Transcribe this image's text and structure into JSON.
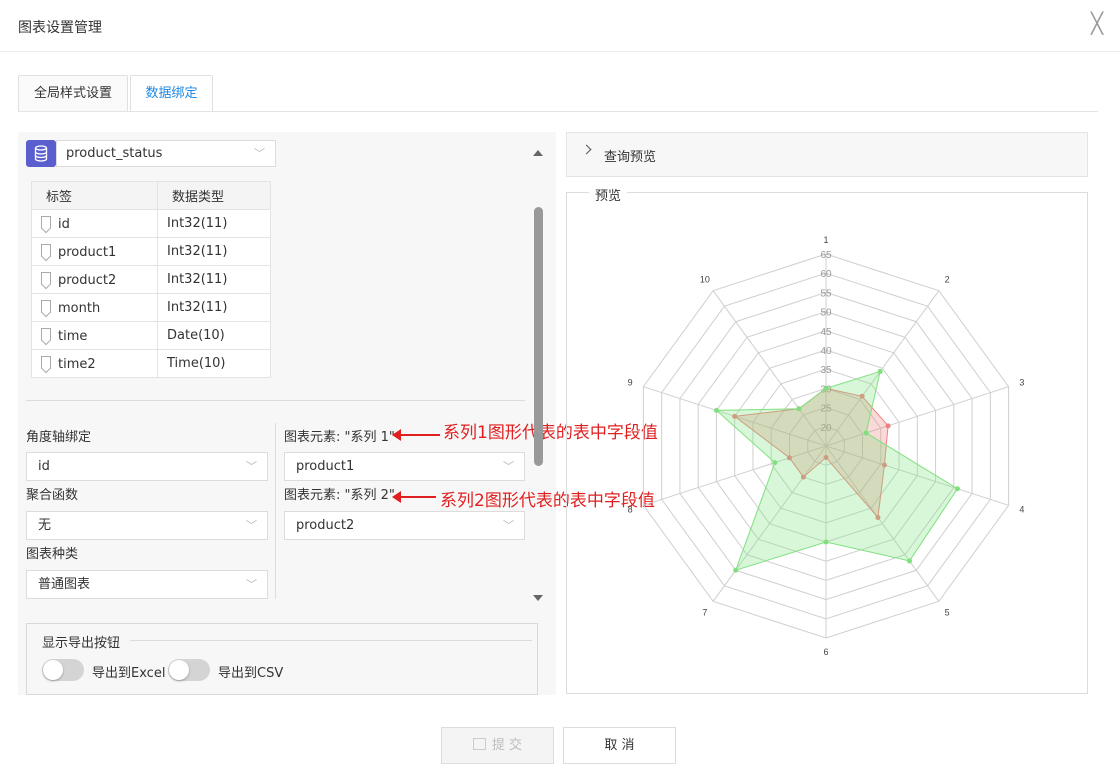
{
  "dialog": {
    "title": "图表设置管理",
    "close_glyph": "╳"
  },
  "tabs": [
    {
      "label": "全局样式设置",
      "active": false
    },
    {
      "label": "数据绑定",
      "active": true
    }
  ],
  "datasource": {
    "selected": "product_status"
  },
  "fields": {
    "headers": [
      "标签",
      "数据类型"
    ],
    "rows": [
      {
        "name": "id",
        "type": "Int32(11)"
      },
      {
        "name": "product1",
        "type": "Int32(11)"
      },
      {
        "name": "product2",
        "type": "Int32(11)"
      },
      {
        "name": "month",
        "type": "Int32(11)"
      },
      {
        "name": "time",
        "type": "Date(10)"
      },
      {
        "name": "time2",
        "type": "Time(10)"
      }
    ]
  },
  "binding": {
    "angle_axis_label": "角度轴绑定",
    "angle_axis_value": "id",
    "aggregate_label": "聚合函数",
    "aggregate_value": "无",
    "chart_kind_label": "图表种类",
    "chart_kind_value": "普通图表",
    "series1_label": "图表元素: \"系列 1\"",
    "series1_value": "product1",
    "series2_label": "图表元素: \"系列 2\"",
    "series2_value": "product2"
  },
  "annotations": {
    "series1": "系列1图形代表的表中字段值",
    "series2": "系列2图形代表的表中字段值"
  },
  "export": {
    "title": "显示导出按钮",
    "excel_label": "导出到Excel",
    "csv_label": "导出到CSV",
    "excel_on": false,
    "csv_on": false
  },
  "query_preview": {
    "label": "查询预览"
  },
  "preview": {
    "label": "预览"
  },
  "buttons": {
    "submit": "提 交",
    "cancel": "取 消"
  },
  "colors": {
    "accent": "#1e88e5",
    "series1": "#f08080",
    "series2": "#7fe07f",
    "annotation": "#e02020"
  },
  "chart_data": {
    "type": "radar",
    "categories": [
      "1",
      "2",
      "3",
      "4",
      "5",
      "6",
      "7",
      "8",
      "9",
      "10"
    ],
    "radial_ticks": [
      "20",
      "25",
      "30",
      "35",
      "40",
      "45",
      "50",
      "55",
      "60",
      "65"
    ],
    "rmin": 15,
    "rmax": 65,
    "series": [
      {
        "values": [
          30,
          31,
          32,
          31,
          38,
          18,
          25,
          25,
          40,
          27
        ],
        "color": "#f08080"
      },
      {
        "values": [
          30,
          39,
          26,
          51,
          52,
          40,
          55,
          29,
          45,
          27
        ],
        "color": "#7fe07f"
      }
    ]
  }
}
